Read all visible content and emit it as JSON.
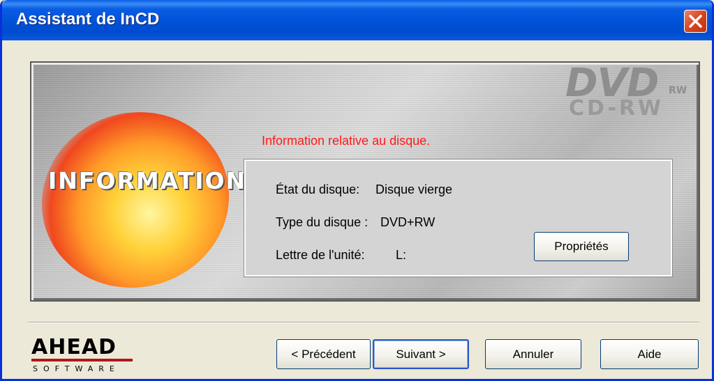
{
  "window": {
    "title": "Assistant de InCD"
  },
  "banner": {
    "info_word": "INFORMATION",
    "logo_dvd": "DVD",
    "logo_rw": "RW",
    "logo_cdrw": "CD-RW"
  },
  "main": {
    "heading": "Information relative au disque.",
    "rows": [
      {
        "label": "État du disque:",
        "value": "Disque vierge"
      },
      {
        "label": "Type du disque :",
        "value": "DVD+RW"
      },
      {
        "label": "Lettre de l'unité:",
        "value": "L:"
      }
    ],
    "properties_button": "Propriétés"
  },
  "footer": {
    "logo_word": "AHEAD",
    "logo_sub": "SOFTWARE",
    "buttons": {
      "previous": "< Précédent",
      "next": "Suivant >",
      "cancel": "Annuler",
      "help": "Aide"
    }
  },
  "colors": {
    "titlebar": "#0052d6",
    "heading_red": "#ff1a1a",
    "close_red": "#d5411c",
    "dialog_bg": "#ece9d8"
  }
}
